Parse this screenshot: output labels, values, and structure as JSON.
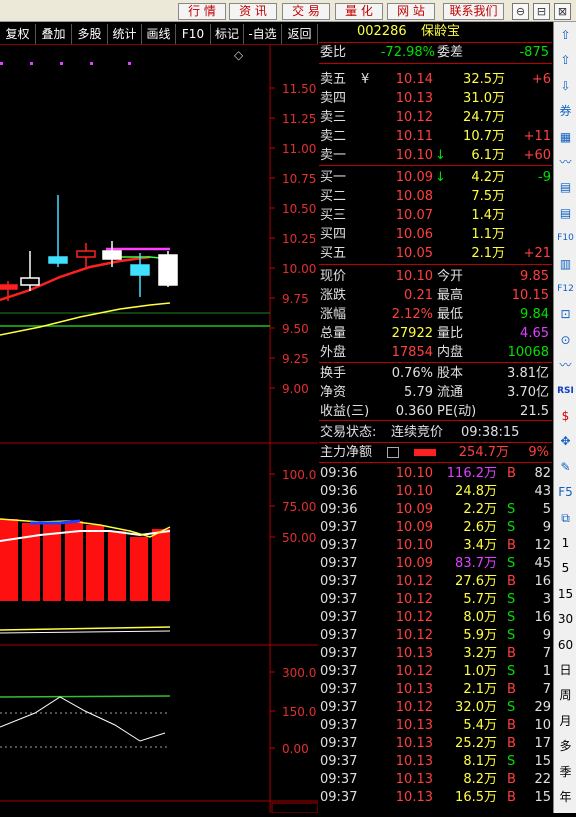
{
  "top_buttons": [
    "行 情",
    "资 讯",
    "交 易",
    "量 化",
    "网 站",
    "联系我们"
  ],
  "win_buttons": [
    "⊖",
    "⊟",
    "⊠"
  ],
  "toolbar": [
    "复权",
    "叠加",
    "多股",
    "统计",
    "画线",
    "F10",
    "标记",
    "-自选",
    "返回"
  ],
  "price_axis": [
    "11.50",
    "11.25",
    "11.00",
    "10.75",
    "10.50",
    "10.25",
    "10.00",
    "9.75",
    "9.50",
    "9.25",
    "9.00"
  ],
  "ind1_axis": [
    "100.0",
    "75.00",
    "50.00"
  ],
  "ind2_axis": [
    "300.0",
    "150.0",
    "0.00"
  ],
  "diamond": "◇",
  "stock": {
    "code": "002286",
    "name": "保龄宝"
  },
  "weibi": {
    "label": "委比",
    "value": "-72.98%",
    "label2": "委差",
    "value2": "-875"
  },
  "sell": [
    {
      "label": "卖五",
      "mark": "¥",
      "price": "10.14",
      "vol": "32.5万",
      "chg": "+6"
    },
    {
      "label": "卖四",
      "mark": "",
      "price": "10.13",
      "vol": "31.0万",
      "chg": ""
    },
    {
      "label": "卖三",
      "mark": "",
      "price": "10.12",
      "vol": "24.7万",
      "chg": ""
    },
    {
      "label": "卖二",
      "mark": "",
      "price": "10.11",
      "vol": "10.7万",
      "chg": "+11"
    },
    {
      "label": "卖一",
      "mark": "",
      "price": "10.10",
      "vol": "6.1万",
      "chg": "+60",
      "arrow": "↓"
    }
  ],
  "buy": [
    {
      "label": "买一",
      "price": "10.09",
      "vol": "4.2万",
      "chg": "-9",
      "arrow": "↓"
    },
    {
      "label": "买二",
      "price": "10.08",
      "vol": "7.5万",
      "chg": ""
    },
    {
      "label": "买三",
      "price": "10.07",
      "vol": "1.4万",
      "chg": ""
    },
    {
      "label": "买四",
      "price": "10.06",
      "vol": "1.1万",
      "chg": ""
    },
    {
      "label": "买五",
      "price": "10.05",
      "vol": "2.1万",
      "chg": "+21"
    }
  ],
  "stats": [
    {
      "l1": "现价",
      "v1": "10.10",
      "l2": "今开",
      "v2": "9.85"
    },
    {
      "l1": "涨跌",
      "v1": "0.21",
      "l2": "最高",
      "v2": "10.15"
    },
    {
      "l1": "涨幅",
      "v1": "2.12%",
      "l2": "最低",
      "v2": "9.84"
    },
    {
      "l1": "总量",
      "v1": "27922",
      "l2": "量比",
      "v2": "4.65"
    },
    {
      "l1": "外盘",
      "v1": "17854",
      "l2": "内盘",
      "v2": "10068"
    }
  ],
  "stats2": [
    {
      "l1": "换手",
      "v1": "0.76%",
      "l2": "股本",
      "v2": "3.81亿"
    },
    {
      "l1": "净资",
      "v1": "5.79",
      "l2": "流通",
      "v2": "3.70亿"
    },
    {
      "l1": "收益(三)",
      "v1": "0.360",
      "l2": "PE(动)",
      "v2": "21.5"
    }
  ],
  "status": {
    "label": "交易状态:",
    "value": "连续竞价",
    "time": "09:38:15"
  },
  "main_flow": {
    "label": "主力净额",
    "value": "254.7万",
    "pct": "9%"
  },
  "ticks": [
    [
      "09:36",
      "10.10",
      "116.2万",
      "B",
      "82"
    ],
    [
      "09:36",
      "10.10",
      "24.8万",
      "",
      "43"
    ],
    [
      "09:36",
      "10.09",
      "2.2万",
      "S",
      "5"
    ],
    [
      "09:37",
      "10.09",
      "2.6万",
      "S",
      "9"
    ],
    [
      "09:37",
      "10.10",
      "3.4万",
      "B",
      "12"
    ],
    [
      "09:37",
      "10.09",
      "83.7万",
      "S",
      "45"
    ],
    [
      "09:37",
      "10.12",
      "27.6万",
      "B",
      "16"
    ],
    [
      "09:37",
      "10.12",
      "5.7万",
      "S",
      "3"
    ],
    [
      "09:37",
      "10.12",
      "8.0万",
      "S",
      "16"
    ],
    [
      "09:37",
      "10.12",
      "5.9万",
      "S",
      "9"
    ],
    [
      "09:37",
      "10.13",
      "3.2万",
      "B",
      "7"
    ],
    [
      "09:37",
      "10.12",
      "1.0万",
      "S",
      "1"
    ],
    [
      "09:37",
      "10.13",
      "2.1万",
      "B",
      "7"
    ],
    [
      "09:37",
      "10.12",
      "32.0万",
      "S",
      "29"
    ],
    [
      "09:37",
      "10.13",
      "5.4万",
      "B",
      "10"
    ],
    [
      "09:37",
      "10.13",
      "25.2万",
      "B",
      "17"
    ],
    [
      "09:37",
      "10.13",
      "8.1万",
      "S",
      "15"
    ],
    [
      "09:37",
      "10.13",
      "8.2万",
      "B",
      "22"
    ],
    [
      "09:37",
      "10.13",
      "16.5万",
      "B",
      "15"
    ]
  ],
  "right_tools": [
    "⇧",
    "⇧",
    "⇩",
    "券",
    "▦",
    "〰",
    "▤",
    "▤",
    "F10",
    "▥",
    "F12",
    "⊡",
    "⊙",
    "〰",
    "RSI",
    "$",
    "✥",
    "✎",
    "F5",
    "⧉",
    "1",
    "5",
    "15",
    "30",
    "60",
    "日",
    "周",
    "月",
    "多",
    "季",
    "年"
  ]
}
